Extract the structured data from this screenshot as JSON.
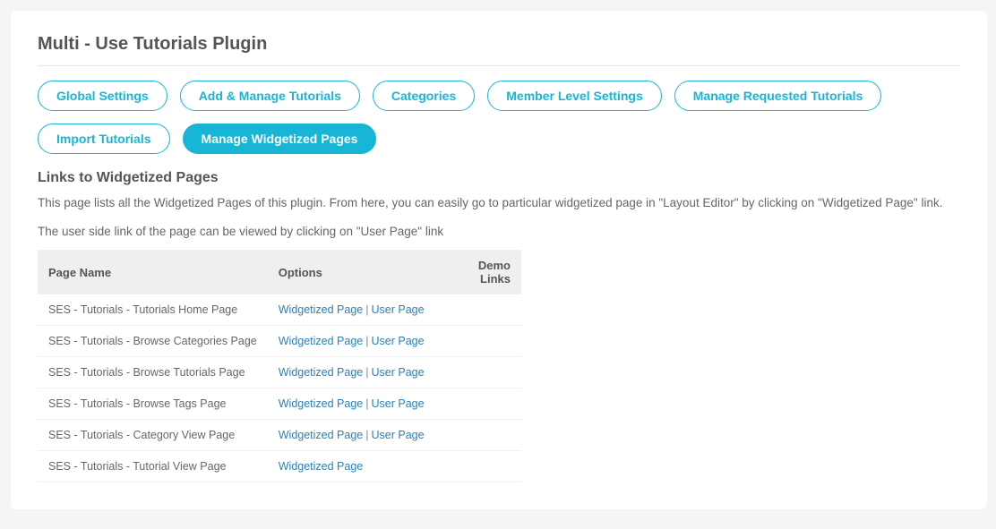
{
  "page_title": "Multi - Use Tutorials Plugin",
  "tabs": [
    {
      "label": "Global Settings",
      "active": false
    },
    {
      "label": "Add & Manage Tutorials",
      "active": false
    },
    {
      "label": "Categories",
      "active": false
    },
    {
      "label": "Member Level Settings",
      "active": false
    },
    {
      "label": "Manage Requested Tutorials",
      "active": false
    },
    {
      "label": "Import Tutorials",
      "active": false
    },
    {
      "label": "Manage Widgetized Pages",
      "active": true
    }
  ],
  "section": {
    "heading": "Links to Widgetized Pages",
    "desc1": "This page lists all the Widgetized Pages of this plugin. From here, you can easily go to particular widgetized page in \"Layout Editor\" by clicking on \"Widgetized Page\" link.",
    "desc2": "The user side link of the page can be viewed by clicking on \"User Page\" link"
  },
  "table": {
    "headers": {
      "page_name": "Page Name",
      "options": "Options",
      "demo_links": "Demo Links"
    },
    "widgetized_label": "Widgetized Page",
    "userpage_label": "User Page",
    "separator": "|",
    "rows": [
      {
        "name": "SES - Tutorials - Tutorials Home Page",
        "has_user_page": true
      },
      {
        "name": "SES - Tutorials - Browse Categories Page",
        "has_user_page": true
      },
      {
        "name": "SES - Tutorials - Browse Tutorials Page",
        "has_user_page": true
      },
      {
        "name": "SES - Tutorials - Browse Tags Page",
        "has_user_page": true
      },
      {
        "name": "SES - Tutorials - Category View Page",
        "has_user_page": true
      },
      {
        "name": "SES - Tutorials - Tutorial View Page",
        "has_user_page": false
      }
    ]
  }
}
